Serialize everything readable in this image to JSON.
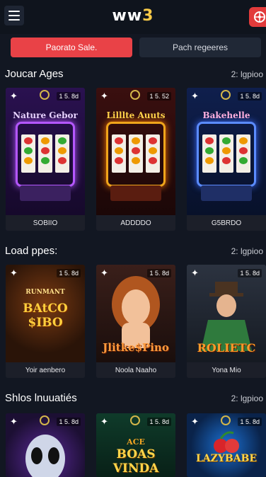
{
  "app": {
    "logo_main": "ww",
    "logo_accent": "3"
  },
  "icons": {
    "menu": "menu-icon",
    "top_right": "wheel-icon"
  },
  "tabs": [
    {
      "label": "Paorato Sale.",
      "active": true
    },
    {
      "label": "Pach regeeres",
      "active": false
    }
  ],
  "sections": [
    {
      "title": "Joucar Ages",
      "more": "2: lgpioo",
      "cards": [
        {
          "title": "Nature Gebor",
          "footer": "SOBIIO",
          "badge": "1 5. 8d",
          "theme": "purple"
        },
        {
          "title": "Lilllte Auuts",
          "footer": "ADDDDO",
          "badge": "1 5. 52",
          "theme": "red"
        },
        {
          "title": "Bakehelle",
          "footer": "G5BRDO",
          "badge": "1 5. 8d",
          "theme": "blue"
        }
      ]
    },
    {
      "title": "Load ppes:",
      "more": "2: lgpioo",
      "cards": [
        {
          "title": "BAtCO $IBO",
          "subtitle": "RUNMANT",
          "footer": "Yoir aenbero",
          "badge": "1 5. 8d",
          "theme": "gold"
        },
        {
          "title": "Jlitke$Pino",
          "footer": "Noola Naaho",
          "badge": "1 5. 8d",
          "theme": "lady"
        },
        {
          "title": "ROLIETC",
          "footer": "Yona Mio",
          "badge": "1 5. 8d",
          "theme": "man"
        }
      ]
    },
    {
      "title": "Shlos lnuuatiés",
      "more": "2: lgpioo",
      "cards": [
        {
          "title": "",
          "footer": "",
          "badge": "1 5. 8d",
          "theme": "alien"
        },
        {
          "title": "BOAS VINDA",
          "subtitle": "ACE",
          "footer": "",
          "badge": "1 5. 8d",
          "theme": "green"
        },
        {
          "title": "LAZYBABE",
          "footer": "",
          "badge": "1 5. 8d",
          "theme": "cherry"
        }
      ]
    }
  ],
  "colors": {
    "accent": "#e94247",
    "bg": "#121722",
    "gold": "#f7c948"
  }
}
